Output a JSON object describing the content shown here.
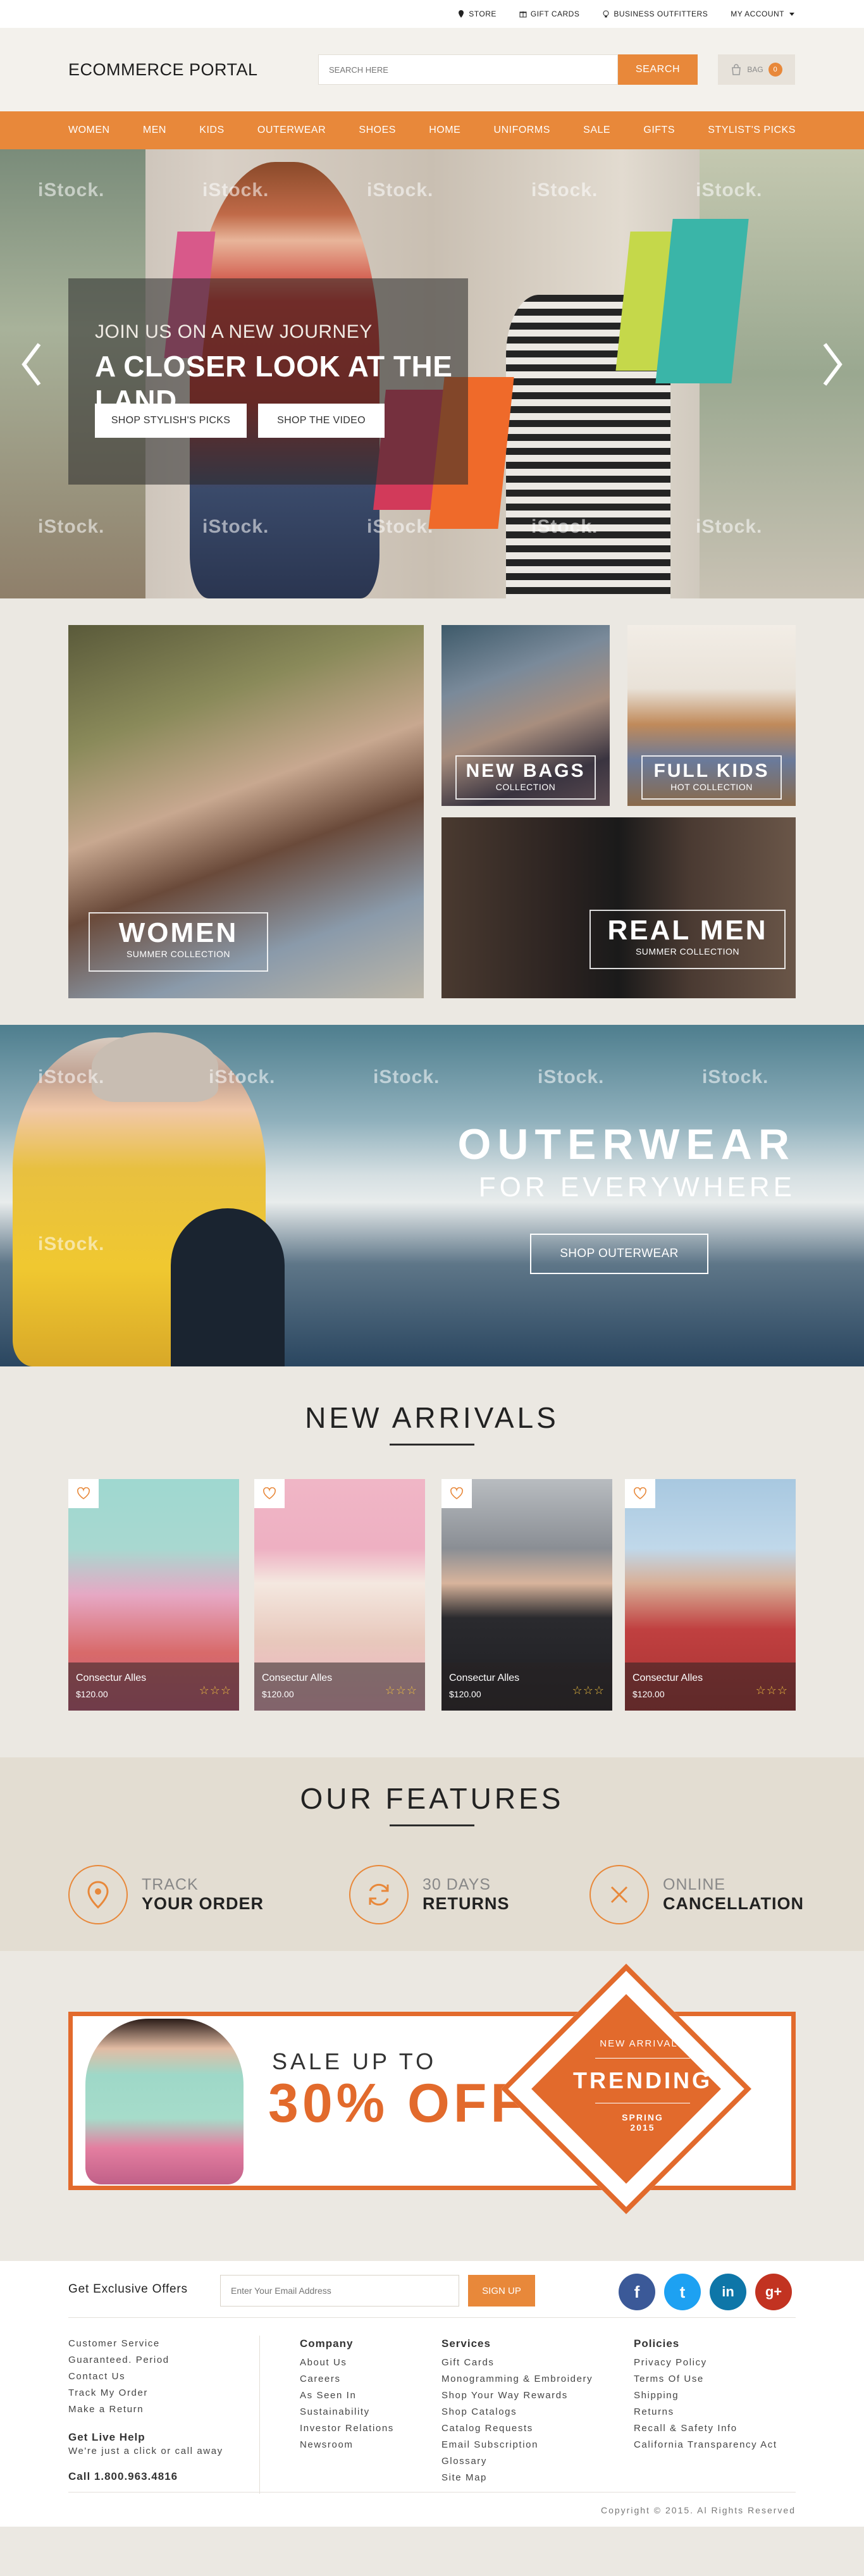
{
  "topbar": {
    "store": "STORE",
    "gift_cards": "GIFT CARDS",
    "business": "BUSINESS OUTFITTERS",
    "account": "MY ACCOUNT"
  },
  "header": {
    "logo": "ECOMMERCE PORTAL",
    "search_placeholder": "SEARCH HERE",
    "search_button": "SEARCH",
    "bag_label": "BAG",
    "bag_count": "0"
  },
  "nav": [
    "WOMEN",
    "MEN",
    "KIDS",
    "OUTERWEAR",
    "SHOES",
    "HOME",
    "UNIFORMS",
    "SALE",
    "GIFTS",
    "STYLIST'S PICKS"
  ],
  "watermark": "iStock.",
  "hero": {
    "line1": "JOIN US ON A NEW JOURNEY",
    "line2": "A CLOSER LOOK AT THE LAND",
    "btn1": "SHOP STYLISH'S PICKS",
    "btn2": "SHOP THE VIDEO"
  },
  "categories": {
    "women": {
      "title": "WOMEN",
      "sub": "SUMMER COLLECTION"
    },
    "bags": {
      "title": "NEW BAGS",
      "sub": "COLLECTION"
    },
    "kids": {
      "title": "FULL KIDS",
      "sub": "HOT COLLECTION"
    },
    "men": {
      "title": "REAL MEN",
      "sub": "SUMMER COLLECTION"
    }
  },
  "outerwear": {
    "title": "OUTERWEAR",
    "subtitle": "FOR EVERYWHERE",
    "button": "SHOP OUTERWEAR"
  },
  "arrivals": {
    "title": "NEW ARRIVALS",
    "products": [
      {
        "name": "Consectur Alles",
        "price": "$120.00",
        "stars": "☆☆☆"
      },
      {
        "name": "Consectur Alles",
        "price": "$120.00",
        "stars": "☆☆☆"
      },
      {
        "name": "Consectur Alles",
        "price": "$120.00",
        "stars": "☆☆☆"
      },
      {
        "name": "Consectur Alles",
        "price": "$120.00",
        "stars": "☆☆☆"
      }
    ]
  },
  "features": {
    "title": "OUR FEATURES",
    "items": [
      {
        "a": "TRACK",
        "b": "YOUR ORDER"
      },
      {
        "a": "30 DAYS",
        "b": "RETURNS"
      },
      {
        "a": "ONLINE",
        "b": "CANCELLATION"
      }
    ]
  },
  "promo": {
    "sale": "SALE UP TO",
    "percent": "30% OFF",
    "badge_top": "NEW ARRIVALS",
    "badge_main": "TRENDING",
    "badge_bottom1": "SPRING",
    "badge_bottom2": "2015"
  },
  "newsletter": {
    "label": "Get Exclusive Offers",
    "placeholder": "Enter Your Email Address",
    "button": "SIGN UP"
  },
  "social": [
    {
      "icon": "f",
      "color": "#3b5998"
    },
    {
      "icon": "t",
      "color": "#1da1f2"
    },
    {
      "icon": "in",
      "color": "#0e76a8"
    },
    {
      "icon": "g+",
      "color": "#c23321"
    }
  ],
  "footer": {
    "col1": {
      "links": [
        "Customer Service",
        "Guaranteed. Period",
        "Contact Us",
        "Track My Order",
        "Make a Return"
      ],
      "help_title": "Get Live Help",
      "help_text": "We're just a click or call away",
      "phone": "Call 1.800.963.4816"
    },
    "col2": {
      "title": "Company",
      "links": [
        "About Us",
        "Careers",
        "As Seen In",
        "Sustainability",
        "Investor Relations",
        "Newsroom"
      ]
    },
    "col3": {
      "title": "Services",
      "links": [
        "Gift Cards",
        "Monogramming & Embroidery",
        "Shop Your Way Rewards",
        "Shop Catalogs",
        "Catalog Requests",
        "Email Subscription",
        "Glossary",
        "Site Map"
      ]
    },
    "col4": {
      "title": "Policies",
      "links": [
        "Privacy Policy",
        "Terms Of Use",
        "Shipping",
        "Returns",
        "Recall & Safety Info",
        "California Transparency Act"
      ]
    },
    "copyright": "Copyright © 2015. Al Rights Reserved"
  }
}
